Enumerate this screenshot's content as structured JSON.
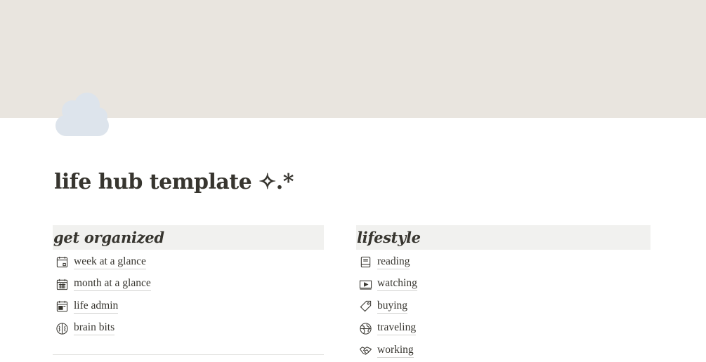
{
  "colors": {
    "cover": "#e9e5df",
    "section_header_bg": "#f1f1ef",
    "text": "#37352f",
    "cloud": "#dde4ec"
  },
  "page": {
    "icon": "cloud-icon",
    "title": "life hub template ✧.*"
  },
  "left_section": {
    "title": "get organized",
    "items": [
      {
        "label": "week at a glance",
        "icon": "calendar-icon"
      },
      {
        "label": "month at a glance",
        "icon": "calendar-month-icon"
      },
      {
        "label": "life admin",
        "icon": "calendar-block-icon"
      },
      {
        "label": "brain bits",
        "icon": "brain-icon"
      }
    ]
  },
  "right_section": {
    "title": "lifestyle",
    "items": [
      {
        "label": "reading",
        "icon": "book-icon"
      },
      {
        "label": "watching",
        "icon": "video-icon"
      },
      {
        "label": "buying",
        "icon": "tag-icon"
      },
      {
        "label": "traveling",
        "icon": "globe-icon"
      },
      {
        "label": "working",
        "icon": "handshake-icon"
      }
    ]
  }
}
